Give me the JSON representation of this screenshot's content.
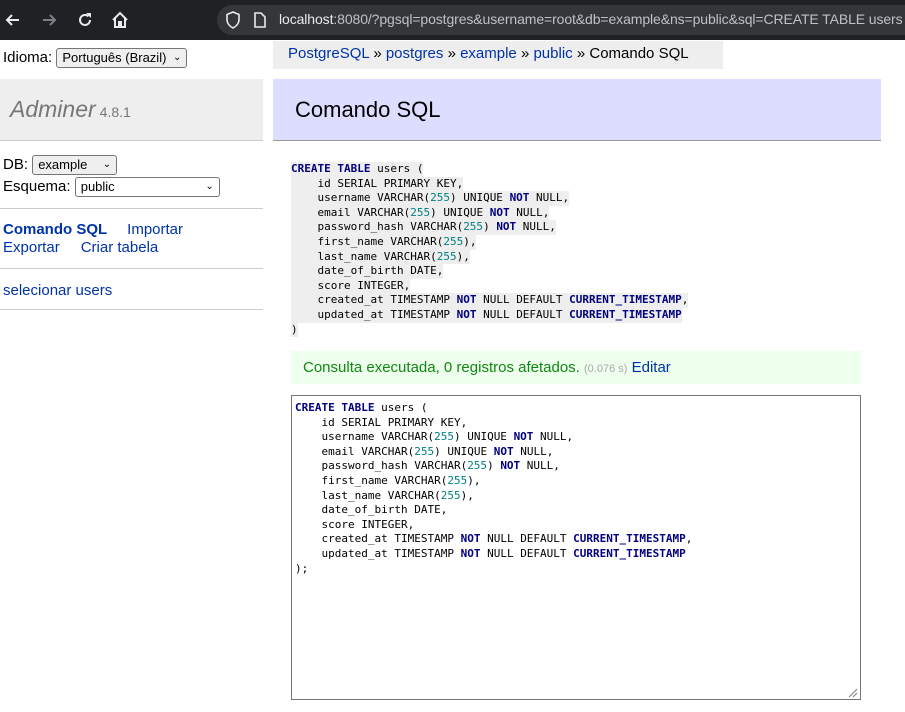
{
  "browser": {
    "url_host": "localhost",
    "url_rest": ":8080/?pgsql=postgres&username=root&db=example&ns=public&sql=CREATE TABLE users"
  },
  "sidebar": {
    "language_label": "Idioma:",
    "language_value": "Português (Brazil)",
    "app_name": "Adminer",
    "app_version": "4.8.1",
    "db_label": "DB:",
    "db_value": "example",
    "schema_label": "Esquema:",
    "schema_value": "public",
    "links": {
      "sql_command": "Comando SQL",
      "import": "Importar",
      "export": "Exportar",
      "create_table": "Criar tabela"
    },
    "tables": [
      "selecionar users"
    ]
  },
  "breadcrumb": {
    "items": [
      "PostgreSQL",
      "postgres",
      "example",
      "public"
    ],
    "separator": "»",
    "current": "Comando SQL"
  },
  "page_title": "Comando SQL",
  "executed_sql": [
    [
      [
        "kw",
        "CREATE TABLE"
      ],
      [
        "t",
        " users ("
      ]
    ],
    [
      [
        "t",
        "    id SERIAL PRIMARY KEY,"
      ]
    ],
    [
      [
        "t",
        "    username VARCHAR("
      ],
      [
        "num",
        "255"
      ],
      [
        "t",
        ") UNIQUE "
      ],
      [
        "kw",
        "NOT"
      ],
      [
        "t",
        " NULL,"
      ]
    ],
    [
      [
        "t",
        "    email VARCHAR("
      ],
      [
        "num",
        "255"
      ],
      [
        "t",
        ") UNIQUE "
      ],
      [
        "kw",
        "NOT"
      ],
      [
        "t",
        " NULL,"
      ]
    ],
    [
      [
        "t",
        "    password_hash VARCHAR("
      ],
      [
        "num",
        "255"
      ],
      [
        "t",
        ") "
      ],
      [
        "kw",
        "NOT"
      ],
      [
        "t",
        " NULL,"
      ]
    ],
    [
      [
        "t",
        "    first_name VARCHAR("
      ],
      [
        "num",
        "255"
      ],
      [
        "t",
        "),"
      ]
    ],
    [
      [
        "t",
        "    last_name VARCHAR("
      ],
      [
        "num",
        "255"
      ],
      [
        "t",
        "),"
      ]
    ],
    [
      [
        "t",
        "    date_of_birth DATE,"
      ]
    ],
    [
      [
        "t",
        "    score INTEGER,"
      ]
    ],
    [
      [
        "t",
        "    created_at TIMESTAMP "
      ],
      [
        "kw",
        "NOT"
      ],
      [
        "t",
        " NULL DEFAULT "
      ],
      [
        "kw",
        "CURRENT_TIMESTAMP"
      ],
      [
        "t",
        ","
      ]
    ],
    [
      [
        "t",
        "    updated_at TIMESTAMP "
      ],
      [
        "kw",
        "NOT"
      ],
      [
        "t",
        " NULL DEFAULT "
      ],
      [
        "kw",
        "CURRENT_TIMESTAMP"
      ]
    ],
    [
      [
        "t",
        ")"
      ]
    ]
  ],
  "result": {
    "message": "Consulta executada, 0 registros afetados.",
    "time": "(0.076 s)",
    "edit_link": "Editar"
  },
  "editor_sql": [
    [
      [
        "kw",
        "CREATE TABLE"
      ],
      [
        "t",
        " users ("
      ]
    ],
    [
      [
        "t",
        "    id SERIAL PRIMARY KEY,"
      ]
    ],
    [
      [
        "t",
        "    username VARCHAR("
      ],
      [
        "num",
        "255"
      ],
      [
        "t",
        ") UNIQUE "
      ],
      [
        "kw",
        "NOT"
      ],
      [
        "t",
        " NULL,"
      ]
    ],
    [
      [
        "t",
        "    email VARCHAR("
      ],
      [
        "num",
        "255"
      ],
      [
        "t",
        ") UNIQUE "
      ],
      [
        "kw",
        "NOT"
      ],
      [
        "t",
        " NULL,"
      ]
    ],
    [
      [
        "t",
        "    password_hash VARCHAR("
      ],
      [
        "num",
        "255"
      ],
      [
        "t",
        ") "
      ],
      [
        "kw",
        "NOT"
      ],
      [
        "t",
        " NULL,"
      ]
    ],
    [
      [
        "t",
        "    first_name VARCHAR("
      ],
      [
        "num",
        "255"
      ],
      [
        "t",
        "),"
      ]
    ],
    [
      [
        "t",
        "    last_name VARCHAR("
      ],
      [
        "num",
        "255"
      ],
      [
        "t",
        "),"
      ]
    ],
    [
      [
        "t",
        "    date_of_birth DATE,"
      ]
    ],
    [
      [
        "t",
        "    score INTEGER,"
      ]
    ],
    [
      [
        "t",
        "    created_at TIMESTAMP "
      ],
      [
        "kw",
        "NOT"
      ],
      [
        "t",
        " NULL DEFAULT "
      ],
      [
        "kw",
        "CURRENT_TIMESTAMP"
      ],
      [
        "t",
        ","
      ]
    ],
    [
      [
        "t",
        "    updated_at TIMESTAMP "
      ],
      [
        "kw",
        "NOT"
      ],
      [
        "t",
        " NULL DEFAULT "
      ],
      [
        "kw",
        "CURRENT_TIMESTAMP"
      ]
    ],
    [
      [
        "t",
        ");"
      ]
    ]
  ]
}
